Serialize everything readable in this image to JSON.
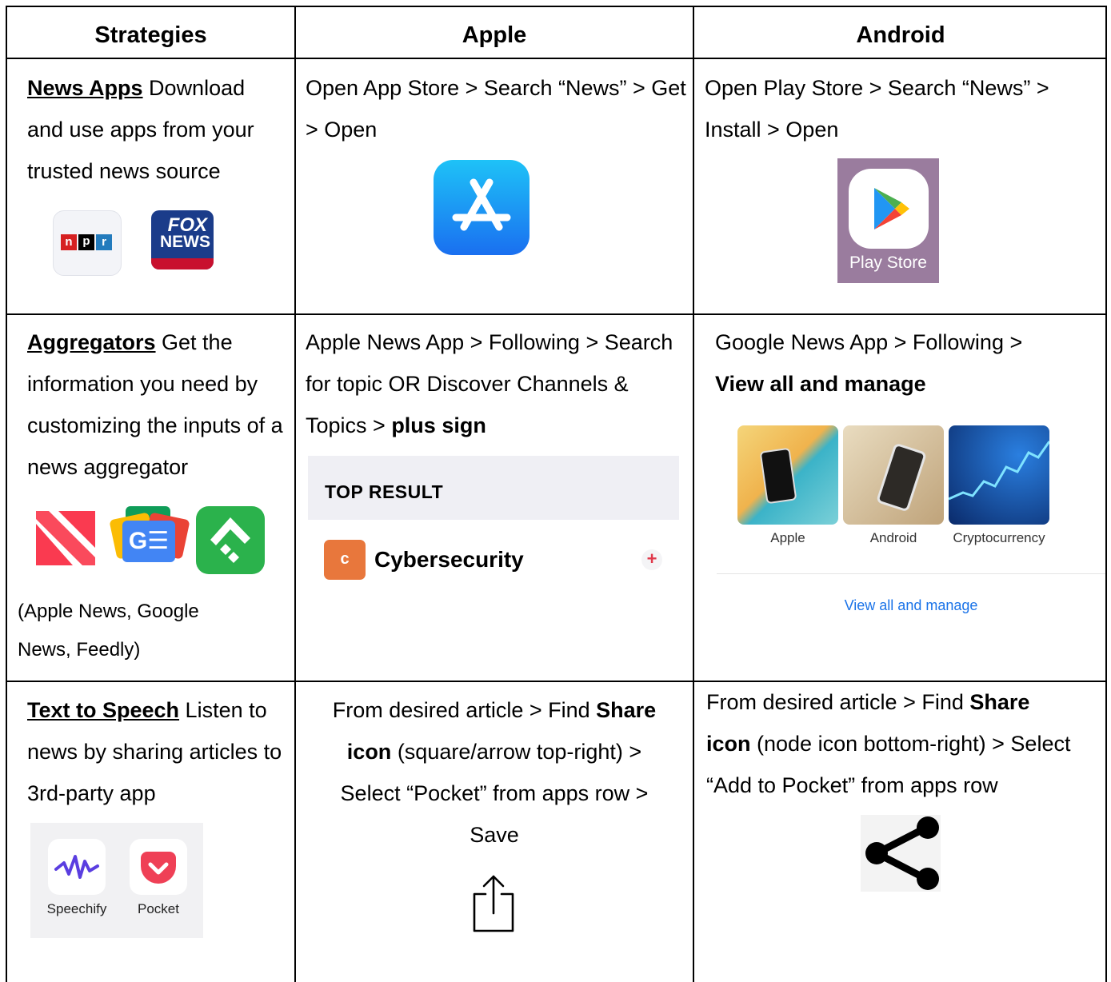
{
  "headers": {
    "strategies": "Strategies",
    "apple": "Apple",
    "android": "Android"
  },
  "row1": {
    "strategy_title": "News Apps",
    "strategy_text": " Download and use apps from your trusted news source",
    "npr_logo": "npr",
    "fox_logo_top": "FOX",
    "fox_logo_bottom": "NEWS",
    "apple_text": "Open App Store > Search “News” > Get > Open",
    "android_text": "Open Play Store > Search “News” > Install > Open",
    "play_store_label": "Play Store"
  },
  "row2": {
    "strategy_title": "Aggregators",
    "strategy_text": " Get the information you need by customizing the inputs of a news aggregator",
    "gnews_logo": "G☰",
    "apps_caption_line1": "(Apple News, Google",
    "apps_caption_line2": "News, Feedly)",
    "apple_text_plain": "Apple News App > Following > Search for topic OR Discover Channels & Topics > ",
    "apple_text_bold": "plus sign",
    "top_result_label": "TOP RESULT",
    "topic_badge": "c",
    "topic_name": "Cybersecurity",
    "plus_sign": "+",
    "android_text_plain": "Google News App > Following >",
    "android_text_bold": "View all and manage",
    "topic_tiles": [
      "Apple",
      "Android",
      "Cryptocurrency"
    ],
    "view_all_link": "View all and manage"
  },
  "row3": {
    "strategy_title": "Text to Speech",
    "strategy_text": " Listen to news by sharing articles to 3rd-party app",
    "speechify_label": "Speechify",
    "pocket_label": "Pocket",
    "apple_line1_plain": "From desired article > Find ",
    "apple_line1_bold": "Share",
    "apple_line2_bold": "icon",
    "apple_line2_plain": " (square/arrow top-right) >",
    "apple_line3": "Select “Pocket” from apps row >",
    "apple_line4": "Save",
    "android_line1_plain": "From desired article > Find ",
    "android_line1_bold": "Share",
    "android_line2_bold": "icon",
    "android_line2_plain": " (node icon bottom-right) > Select",
    "android_line3": "“Add to Pocket” from apps row"
  },
  "colors": {
    "npr_red": "#d62021",
    "npr_black": "#000000",
    "npr_blue": "#237bbd",
    "fox_blue": "#1b3c8a",
    "fox_red": "#c8102e",
    "appstore_blue": "#1a8ef2",
    "playstore_bg": "#9a7c9e",
    "topic_orange": "#e8773c",
    "top_result_bg": "#efeff4",
    "view_all_blue": "#1a73e8",
    "feedly_green": "#2bb24c",
    "pocket_red": "#ef4056",
    "speechify_purple": "#5a3ee0"
  }
}
